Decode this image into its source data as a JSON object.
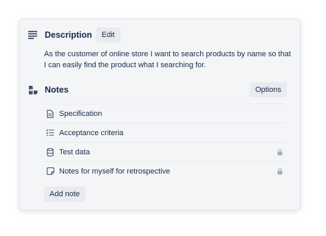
{
  "description": {
    "title": "Description",
    "edit_label": "Edit",
    "text": "As the customer of online store I want to search products by name so that I can easily find the product what I searching for."
  },
  "notes": {
    "title": "Notes",
    "options_label": "Options",
    "items": [
      {
        "label": "Specification",
        "icon": "document-icon",
        "locked": false
      },
      {
        "label": "Acceptance criteria",
        "icon": "checklist-icon",
        "locked": false
      },
      {
        "label": "Test data",
        "icon": "database-icon",
        "locked": true
      },
      {
        "label": "Notes for myself for retrospective",
        "icon": "sticky-note-icon",
        "locked": true
      }
    ],
    "add_label": "Add note"
  },
  "colors": {
    "card_background": "#f4f5f7",
    "text": "#172b4d",
    "button_background": "#e9ebee",
    "icon": "#42526e",
    "lock": "#a5adba"
  }
}
